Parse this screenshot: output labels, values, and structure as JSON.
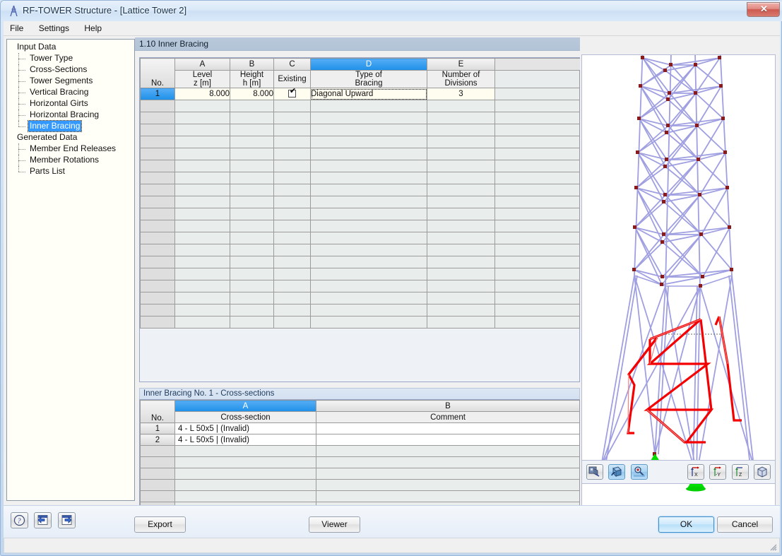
{
  "window": {
    "title": "RF-TOWER Structure - [Lattice Tower 2]",
    "app_icon": "tower-icon",
    "close_label": "✕"
  },
  "menubar": {
    "items": [
      {
        "label": "File"
      },
      {
        "label": "Settings"
      },
      {
        "label": "Help"
      }
    ]
  },
  "sidebar": {
    "groups": [
      {
        "label": "Input Data",
        "items": [
          {
            "label": "Tower Type",
            "selected": false
          },
          {
            "label": "Cross-Sections",
            "selected": false
          },
          {
            "label": "Tower Segments",
            "selected": false
          },
          {
            "label": "Vertical Bracing",
            "selected": false
          },
          {
            "label": "Horizontal Girts",
            "selected": false
          },
          {
            "label": "Horizontal Bracing",
            "selected": false
          },
          {
            "label": "Inner Bracing",
            "selected": true
          }
        ]
      },
      {
        "label": "Generated Data",
        "items": [
          {
            "label": "Member End Releases",
            "selected": false
          },
          {
            "label": "Member Rotations",
            "selected": false
          },
          {
            "label": "Parts List",
            "selected": false
          }
        ]
      }
    ]
  },
  "main": {
    "section_title": "1.10 Inner Bracing",
    "grid": {
      "column_letters": [
        "A",
        "B",
        "C",
        "D",
        "E"
      ],
      "selected_column_letter": "D",
      "rowno_header": "No.",
      "headers": [
        {
          "line1": "Level",
          "line2": "z [m]"
        },
        {
          "line1": "Height",
          "line2": "h [m]"
        },
        {
          "line1": "",
          "line2": "Existing"
        },
        {
          "line1": "Type of",
          "line2": "Bracing"
        },
        {
          "line1": "Number of",
          "line2": "Divisions"
        }
      ],
      "rows": [
        {
          "no": "1",
          "level_z": "8.000",
          "height_h": "8.000",
          "existing": true,
          "type_of_bracing": "Diagonal Upward",
          "number_of_divisions": "3"
        }
      ],
      "empty_rows": 18
    }
  },
  "subpanel": {
    "title": "Inner Bracing No. 1 - Cross-sections",
    "grid": {
      "column_letters": [
        "A",
        "B"
      ],
      "selected_column_letter": "A",
      "rowno_header": "No.",
      "headers": [
        "Cross-section",
        "Comment"
      ],
      "rows": [
        {
          "no": "1",
          "cross_section": "4 - L 50x5 | (Invalid)",
          "comment": ""
        },
        {
          "no": "2",
          "cross_section": "4 - L 50x5 | (Invalid)",
          "comment": ""
        }
      ],
      "empty_rows": 6
    },
    "toolbar": {
      "info_icon": "info-icon",
      "prev_icon": "triangle-left-icon",
      "next_icon": "triangle-right-icon",
      "return_icon": "return-arrow-icon",
      "prev_enabled": false,
      "next_enabled": false
    }
  },
  "viewer": {
    "toolbar": {
      "left_buttons": [
        {
          "icon": "render-mode-icon",
          "active": false
        },
        {
          "icon": "rotate-view-icon",
          "active": true
        },
        {
          "icon": "zoom-view-icon",
          "active": true
        }
      ],
      "right_buttons": [
        {
          "icon": "view-x-icon",
          "label": "X",
          "active": false
        },
        {
          "icon": "view-minus-y-icon",
          "label": "-Y",
          "active": false
        },
        {
          "icon": "view-z-icon",
          "label": "Z",
          "active": false
        },
        {
          "icon": "view-isometric-icon",
          "label": "",
          "active": false
        }
      ]
    },
    "model": {
      "name": "lattice-tower",
      "member_color": "#9a9ae0",
      "node_color": "#8b1a1a",
      "highlight_color": "#f40000",
      "support_color": "#00dd00"
    }
  },
  "footer": {
    "help_icon": "question-mark-icon",
    "back_icon": "back-arrow-icon",
    "forward_icon": "forward-arrow-icon",
    "export_label": "Export",
    "viewer_label": "Viewer",
    "ok_label": "OK",
    "cancel_label": "Cancel"
  },
  "statusbar": {
    "text": ""
  }
}
